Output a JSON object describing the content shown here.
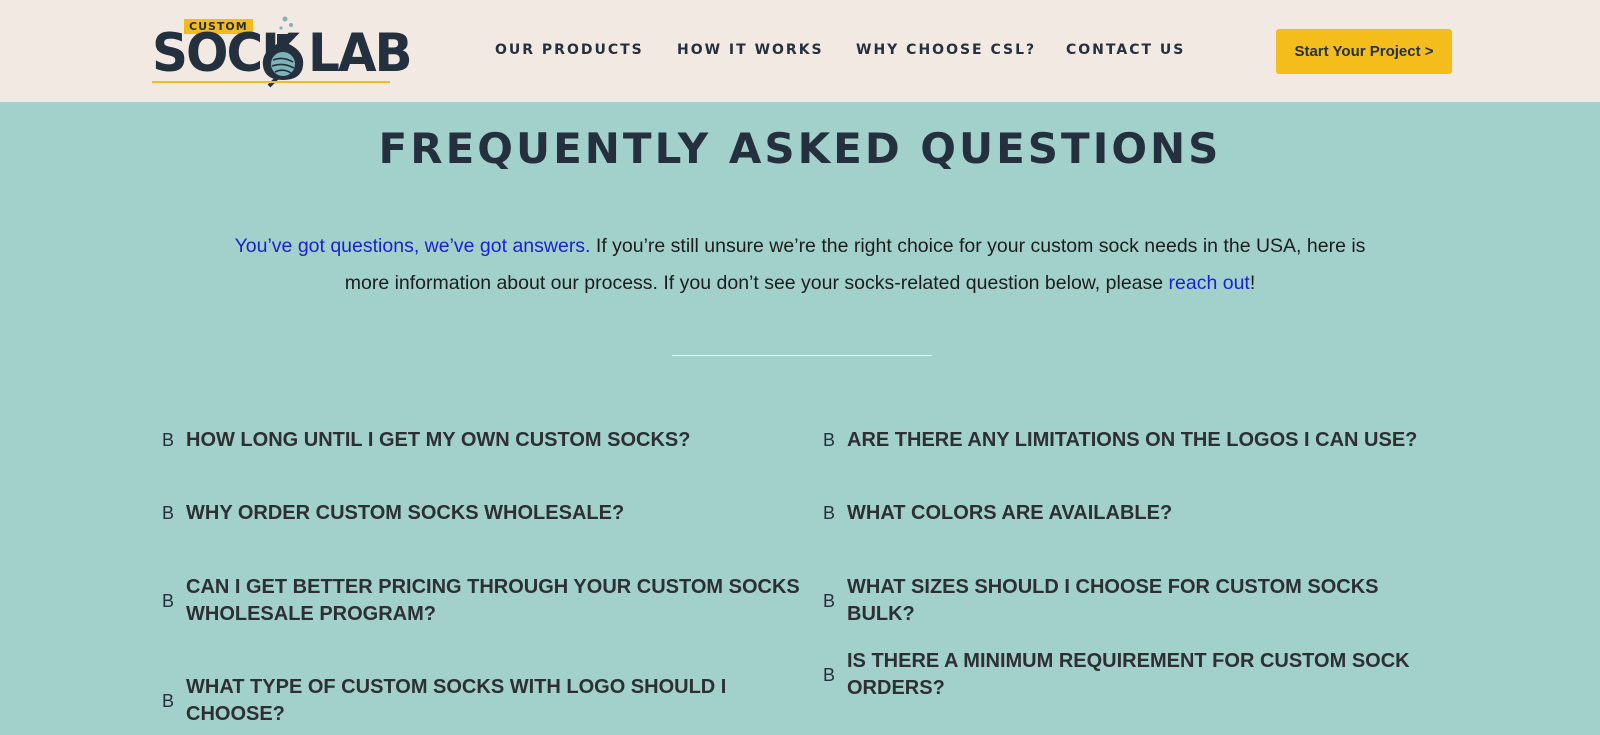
{
  "header": {
    "logo": {
      "badge": "CUSTOM",
      "word_left": "SOCK",
      "word_right": "LAB"
    },
    "nav": [
      "OUR PRODUCTS",
      "HOW IT WORKS",
      "WHY CHOOSE CSL?",
      "CONTACT US"
    ],
    "cta_label": "Start Your Project >"
  },
  "faq": {
    "title": "FREQUENTLY ASKED QUESTIONS",
    "intro": {
      "link1": "You’ve got questions, we’ve got answers.",
      "text1": " If you’re still unsure we’re the right choice for your custom sock needs in the USA, here is more information about our process. If you don’t see your socks-related question below, please ",
      "link2": "reach out",
      "text2": "!"
    },
    "icon_glyph": "B",
    "left_questions": [
      "HOW LONG UNTIL I GET MY OWN CUSTOM SOCKS?",
      "WHY ORDER CUSTOM SOCKS WHOLESALE?",
      "CAN I GET BETTER PRICING THROUGH YOUR CUSTOM SOCKS WHOLESALE PROGRAM?",
      "WHAT TYPE OF CUSTOM SOCKS WITH LOGO SHOULD I CHOOSE?"
    ],
    "right_questions": [
      "ARE THERE ANY LIMITATIONS ON THE LOGOS I CAN USE?",
      "WHAT COLORS ARE AVAILABLE?",
      "WHAT SIZES SHOULD I CHOOSE FOR CUSTOM SOCKS BULK?",
      "IS THERE A MINIMUM REQUIREMENT FOR CUSTOM SOCK ORDERS?"
    ]
  },
  "colors": {
    "background": "#a2d1cc",
    "header_bg": "#f3e9e3",
    "accent_yellow": "#f4bd1c",
    "navy": "#25303f",
    "link_blue": "#1a1fd6"
  }
}
